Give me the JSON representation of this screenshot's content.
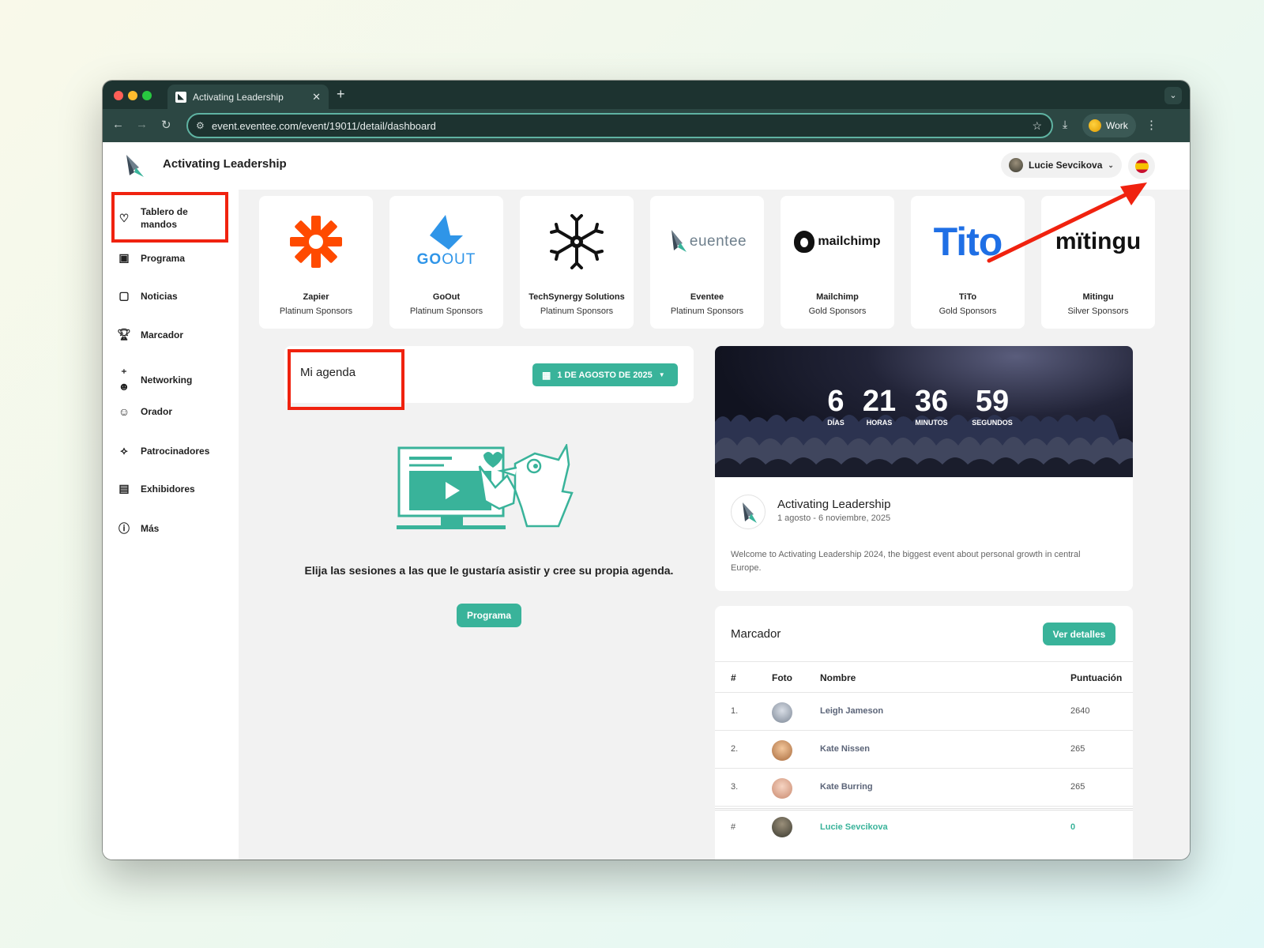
{
  "browser": {
    "tab_title": "Activating Leadership",
    "tab_close": "✕",
    "new_tab": "+",
    "url": "event.eventee.com/event/19011/detail/dashboard",
    "profile_label": "Work"
  },
  "header": {
    "event_title": "Activating Leadership",
    "user_name": "Lucie Sevcikova",
    "language": "es"
  },
  "sidebar": {
    "items": [
      {
        "label": "Tablero de mandos",
        "icon": "heart-hand-icon"
      },
      {
        "label": "Programa",
        "icon": "calendar-icon"
      },
      {
        "label": "Noticias",
        "icon": "image-icon"
      },
      {
        "label": "Marcador",
        "icon": "trophy-icon"
      },
      {
        "label": "Networking",
        "icon": "people-add-icon"
      },
      {
        "label": "Orador",
        "icon": "group-icon"
      },
      {
        "label": "Patrocinadores",
        "icon": "handshake-icon"
      },
      {
        "label": "Exhibidores",
        "icon": "badge-icon"
      },
      {
        "label": "Más",
        "icon": "info-icon"
      }
    ]
  },
  "sponsors": [
    {
      "name": "Zapier",
      "tier": "Platinum Sponsors"
    },
    {
      "name": "GoOut",
      "tier": "Platinum Sponsors",
      "logo_text_a": "GO",
      "logo_text_b": "OUT"
    },
    {
      "name": "TechSynergy Solutions",
      "tier": "Platinum Sponsors"
    },
    {
      "name": "Eventee",
      "tier": "Platinum Sponsors",
      "logo_text": "euentee"
    },
    {
      "name": "Mailchimp",
      "tier": "Gold Sponsors",
      "logo_text": "mailchimp"
    },
    {
      "name": "TiTo",
      "tier": "Gold Sponsors",
      "logo_text": "Tito"
    },
    {
      "name": "Mitingu",
      "tier": "Silver Sponsors",
      "logo_text": "mïtingu"
    }
  ],
  "agenda": {
    "title": "Mi agenda",
    "date_label": "1 DE AGOSTO DE 2025",
    "empty_message": "Elija las sesiones a las que le gustaría asistir y cree su propia agenda.",
    "program_button": "Programa"
  },
  "event_card": {
    "countdown": [
      {
        "value": "6",
        "unit": "DÍAS"
      },
      {
        "value": "21",
        "unit": "HORAS"
      },
      {
        "value": "36",
        "unit": "MINUTOS"
      },
      {
        "value": "59",
        "unit": "SEGUNDOS"
      }
    ],
    "name": "Activating Leadership",
    "dates": "1 agosto - 6 noviembre, 2025",
    "description": "Welcome to Activating Leadership 2024, the biggest event about personal growth in central Europe."
  },
  "leaderboard": {
    "title": "Marcador",
    "details_button": "Ver detalles",
    "columns": [
      "#",
      "Foto",
      "Nombre",
      "Puntuación"
    ],
    "rows": [
      {
        "rank": "1.",
        "name": "Leigh Jameson",
        "score": "2640"
      },
      {
        "rank": "2.",
        "name": "Kate Nissen",
        "score": "265"
      },
      {
        "rank": "3.",
        "name": "Kate Burring",
        "score": "265"
      },
      {
        "rank": "#",
        "name": "Lucie Sevcikova",
        "score": "0"
      }
    ]
  },
  "colors": {
    "accent": "#39b39a",
    "annotation": "#f0220f",
    "browser_frame": "#2c4743"
  }
}
